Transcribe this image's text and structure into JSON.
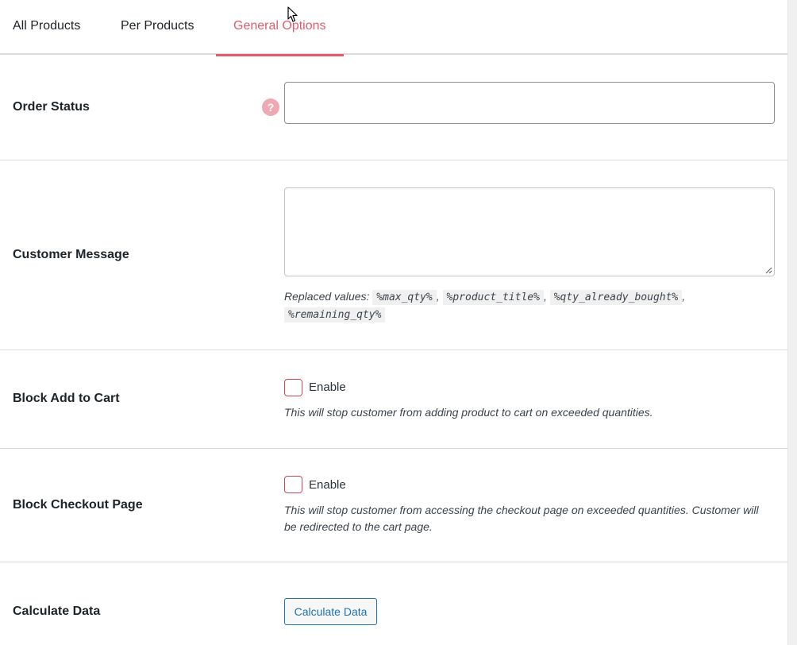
{
  "tabs": [
    {
      "label": "All Products",
      "active": false
    },
    {
      "label": "Per Products",
      "active": false
    },
    {
      "label": "General Options",
      "active": true
    }
  ],
  "order_status": {
    "label": "Order Status",
    "help_icon": "question-mark-icon",
    "help_glyph": "?",
    "value": ""
  },
  "customer_message": {
    "label": "Customer Message",
    "value": "",
    "replaced_prefix": "Replaced values:",
    "tokens": [
      "%max_qty%",
      "%product_title%",
      "%qty_already_bought%",
      "%remaining_qty%"
    ],
    "separator": ","
  },
  "block_add_to_cart": {
    "label": "Block Add to Cart",
    "checkbox_label": "Enable",
    "checked": false,
    "description": "This will stop customer from adding product to cart on exceeded quantities."
  },
  "block_checkout": {
    "label": "Block Checkout Page",
    "checkbox_label": "Enable",
    "checked": false,
    "description_line1": "This will stop customer from accessing the checkout page on exceeded quantities. Customer will",
    "description_line2": "be redirected to the cart page."
  },
  "calculate_data": {
    "label": "Calculate Data",
    "button_label": "Calculate Data"
  },
  "colors": {
    "accent": "#e05d6f",
    "button_blue": "#2271b1",
    "checkbox_border": "#c9485b"
  }
}
